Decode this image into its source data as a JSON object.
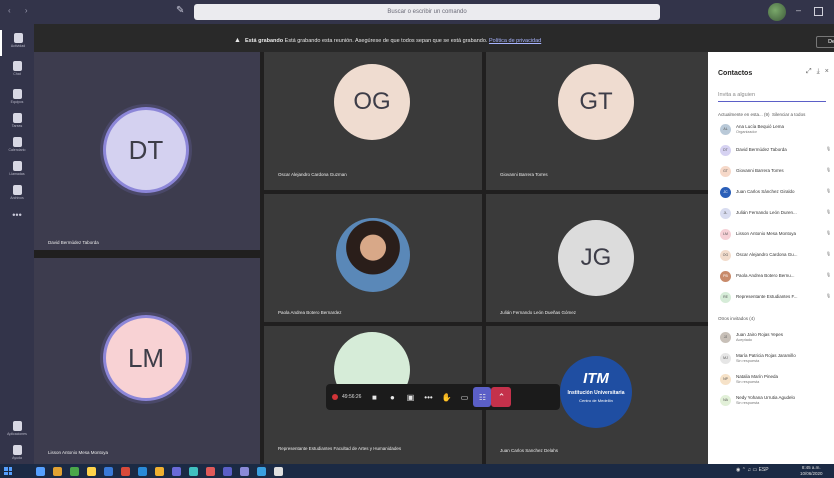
{
  "titlebar": {
    "search_placeholder": "Buscar o escribir un comando"
  },
  "rail": {
    "items": [
      {
        "label": "Actividad",
        "icon": "bell-icon"
      },
      {
        "label": "Chat",
        "icon": "chat-icon"
      },
      {
        "label": "Equipos",
        "icon": "teams-icon"
      },
      {
        "label": "Tareas",
        "icon": "tasks-icon"
      },
      {
        "label": "Calendario",
        "icon": "calendar-icon"
      },
      {
        "label": "Llamadas",
        "icon": "phone-icon"
      },
      {
        "label": "Archivos",
        "icon": "files-icon"
      }
    ],
    "more_label": "•••",
    "apps_label": "Aplicaciones",
    "help_label": "Ayuda"
  },
  "banner": {
    "status": "Está grabando",
    "message": "Está grabando esta reunión. Asegúrese de que todos sepan que se está grabando.",
    "link": "Política de privacidad",
    "dismiss": "Descartar"
  },
  "participants": {
    "dt": {
      "initials": "DT",
      "name": "David Bermúdez Taborda"
    },
    "og": {
      "initials": "OG",
      "name": "Oscar Alejandro Cardona Guzman"
    },
    "gt": {
      "initials": "GT",
      "name": "Giovanni Barrera Torres"
    },
    "paola": {
      "name": "Paola Andrea Botero Bernardez"
    },
    "jg": {
      "initials": "JG",
      "name": "Julián Fernando León Dueñas Gómez"
    },
    "lm": {
      "initials": "LM",
      "name": "Lisson Antonio Mesa Montoya"
    },
    "rep": {
      "name": "Representante Estudiantes Facultad de Artes y Humanidades"
    },
    "juan": {
      "name": "Juan Carlos Sanchez Delahs",
      "logo_text": "ITM",
      "logo_sub1": "Institución Universitaria",
      "logo_sub2": "Centro de Medellín"
    }
  },
  "controls": {
    "timer": "49:56:26"
  },
  "contacts": {
    "title": "Contactos",
    "invite_placeholder": "Invita a alguien",
    "in_meeting_header": "Actualmente en esta... (9)",
    "mute_all": "Silenciar a todos",
    "in_meeting": [
      {
        "name": "Ana Lucía Bequió Lema",
        "role": "Organizador",
        "initials": "AL",
        "color": "#b9c9d8"
      },
      {
        "name": "David Bermúdez Taborda",
        "role": "",
        "initials": "DT",
        "color": "#d6d2f2"
      },
      {
        "name": "Giovanni Barrera Torres",
        "role": "",
        "initials": "GT",
        "color": "#f6d8c8"
      },
      {
        "name": "Juan Carlos Sánchez Giraldo",
        "role": "",
        "initials": "JC",
        "color": "#2b5fb8"
      },
      {
        "name": "Julián Fernando León Duren...",
        "role": "",
        "initials": "JL",
        "color": "#d8dcf0"
      },
      {
        "name": "Lisson Antonio Mesa Montoya",
        "role": "",
        "initials": "LM",
        "color": "#f6d0d6"
      },
      {
        "name": "Óscar Alejandro Cardona Gu...",
        "role": "",
        "initials": "OG",
        "color": "#f2dccc"
      },
      {
        "name": "Paola Andrea Botero Bernu...",
        "role": "",
        "initials": "PB",
        "color": "#c88a6a"
      },
      {
        "name": "Representante Estudiantes F...",
        "role": "",
        "initials": "RE",
        "color": "#d6ecd8"
      }
    ],
    "others_header": "Otros invitados (4)",
    "others": [
      {
        "name": "Juan Jairo Rojas Yepes",
        "role": "Aceptado",
        "initials": "JJ",
        "color": "#c8c0b8"
      },
      {
        "name": "María Patricia Rojas Jaramillo",
        "role": "Sin respuesta",
        "initials": "MJ",
        "color": "#e6e6e6"
      },
      {
        "name": "Natalia Marín Pineda",
        "role": "Sin respuesta",
        "initials": "NP",
        "color": "#f6e2c8"
      },
      {
        "name": "Nedy Yohana Urrutia Agudelo",
        "role": "Sin respuesta",
        "initials": "NA",
        "color": "#e2f0d8"
      }
    ]
  },
  "taskbar": {
    "time": "8:45 a.m.",
    "date": "10/06/2020"
  },
  "colors": {
    "rail": "#33344a",
    "accent": "#5b5fc7",
    "hangup": "#c4314b"
  }
}
